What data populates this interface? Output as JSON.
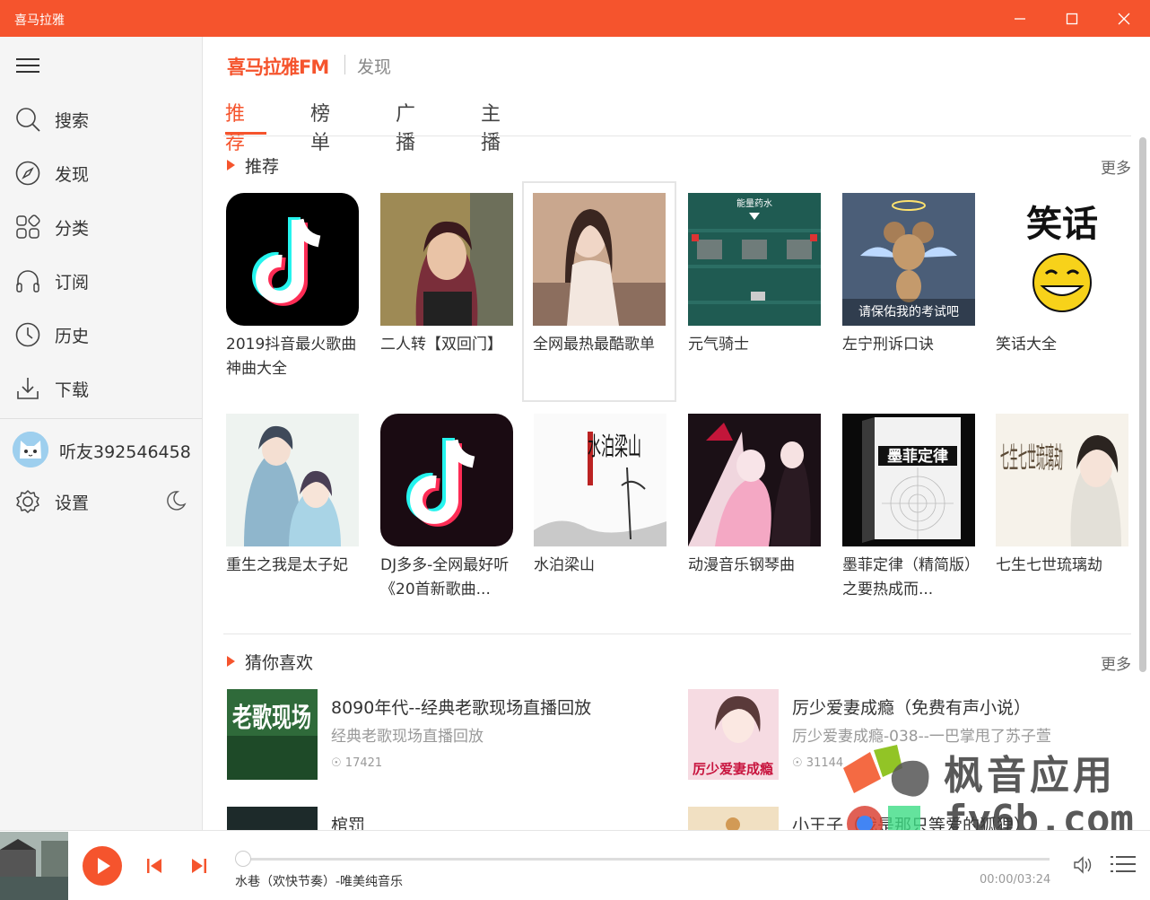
{
  "window": {
    "title": "喜马拉雅"
  },
  "sidebar": {
    "items": [
      {
        "label": "搜索",
        "icon": "search-icon"
      },
      {
        "label": "发现",
        "icon": "compass-icon"
      },
      {
        "label": "分类",
        "icon": "category-icon"
      },
      {
        "label": "订阅",
        "icon": "headphones-icon"
      },
      {
        "label": "历史",
        "icon": "clock-icon"
      },
      {
        "label": "下载",
        "icon": "download-icon"
      }
    ],
    "user": {
      "name": "听友392546458"
    },
    "settings_label": "设置"
  },
  "header": {
    "brand": "喜马拉雅FM",
    "section": "发现"
  },
  "tabs": [
    "推荐",
    "榜单",
    "广播",
    "主播"
  ],
  "recommend": {
    "title": "推荐",
    "more": "更多",
    "cards": [
      {
        "title": "2019抖音最火歌曲神曲大全"
      },
      {
        "title": "二人转【双回门】"
      },
      {
        "title": "全网最热最酷歌单"
      },
      {
        "title": "元气骑士",
        "cover_text": "能量药水"
      },
      {
        "title": "左宁刑诉口诀",
        "cover_text": "请保佑我的考试吧"
      },
      {
        "title": "笑话大全",
        "cover_text": "笑话"
      },
      {
        "title": "重生之我是太子妃"
      },
      {
        "title": "DJ多多-全网最好听《20首新歌曲..."
      },
      {
        "title": "水泊梁山",
        "cover_text": "水泊梁山"
      },
      {
        "title": "动漫音乐钢琴曲"
      },
      {
        "title": "墨菲定律（精简版）之要热成而...",
        "cover_text": "墨菲定律"
      },
      {
        "title": "七生七世琉璃劫",
        "cover_text": "七生七世琉璃劫"
      }
    ]
  },
  "guess": {
    "title": "猜你喜欢",
    "more": "更多",
    "items": [
      {
        "title": "8090年代--经典老歌现场直播回放",
        "subtitle": "经典老歌现场直播回放",
        "plays": "17421",
        "cover_text": "老歌现场"
      },
      {
        "title": "厉少爱妻成瘾（免费有声小说）",
        "subtitle": "厉少爱妻成瘾-038--一巴掌甩了苏子萱",
        "plays": "31144",
        "cover_text": "厉少爱妻成瘾"
      },
      {
        "title": "棺罚",
        "subtitle": "",
        "plays": ""
      },
      {
        "title": "小王子（我是那只等爱的狐狸）",
        "subtitle": "",
        "plays": ""
      }
    ]
  },
  "player": {
    "song": "水巷（欢快节奏）-唯美纯音乐",
    "time": "00:00/03:24"
  },
  "watermark": {
    "line1": "枫音应用",
    "line2": "fy6b.com"
  },
  "colors": {
    "accent": "#f5542d"
  }
}
